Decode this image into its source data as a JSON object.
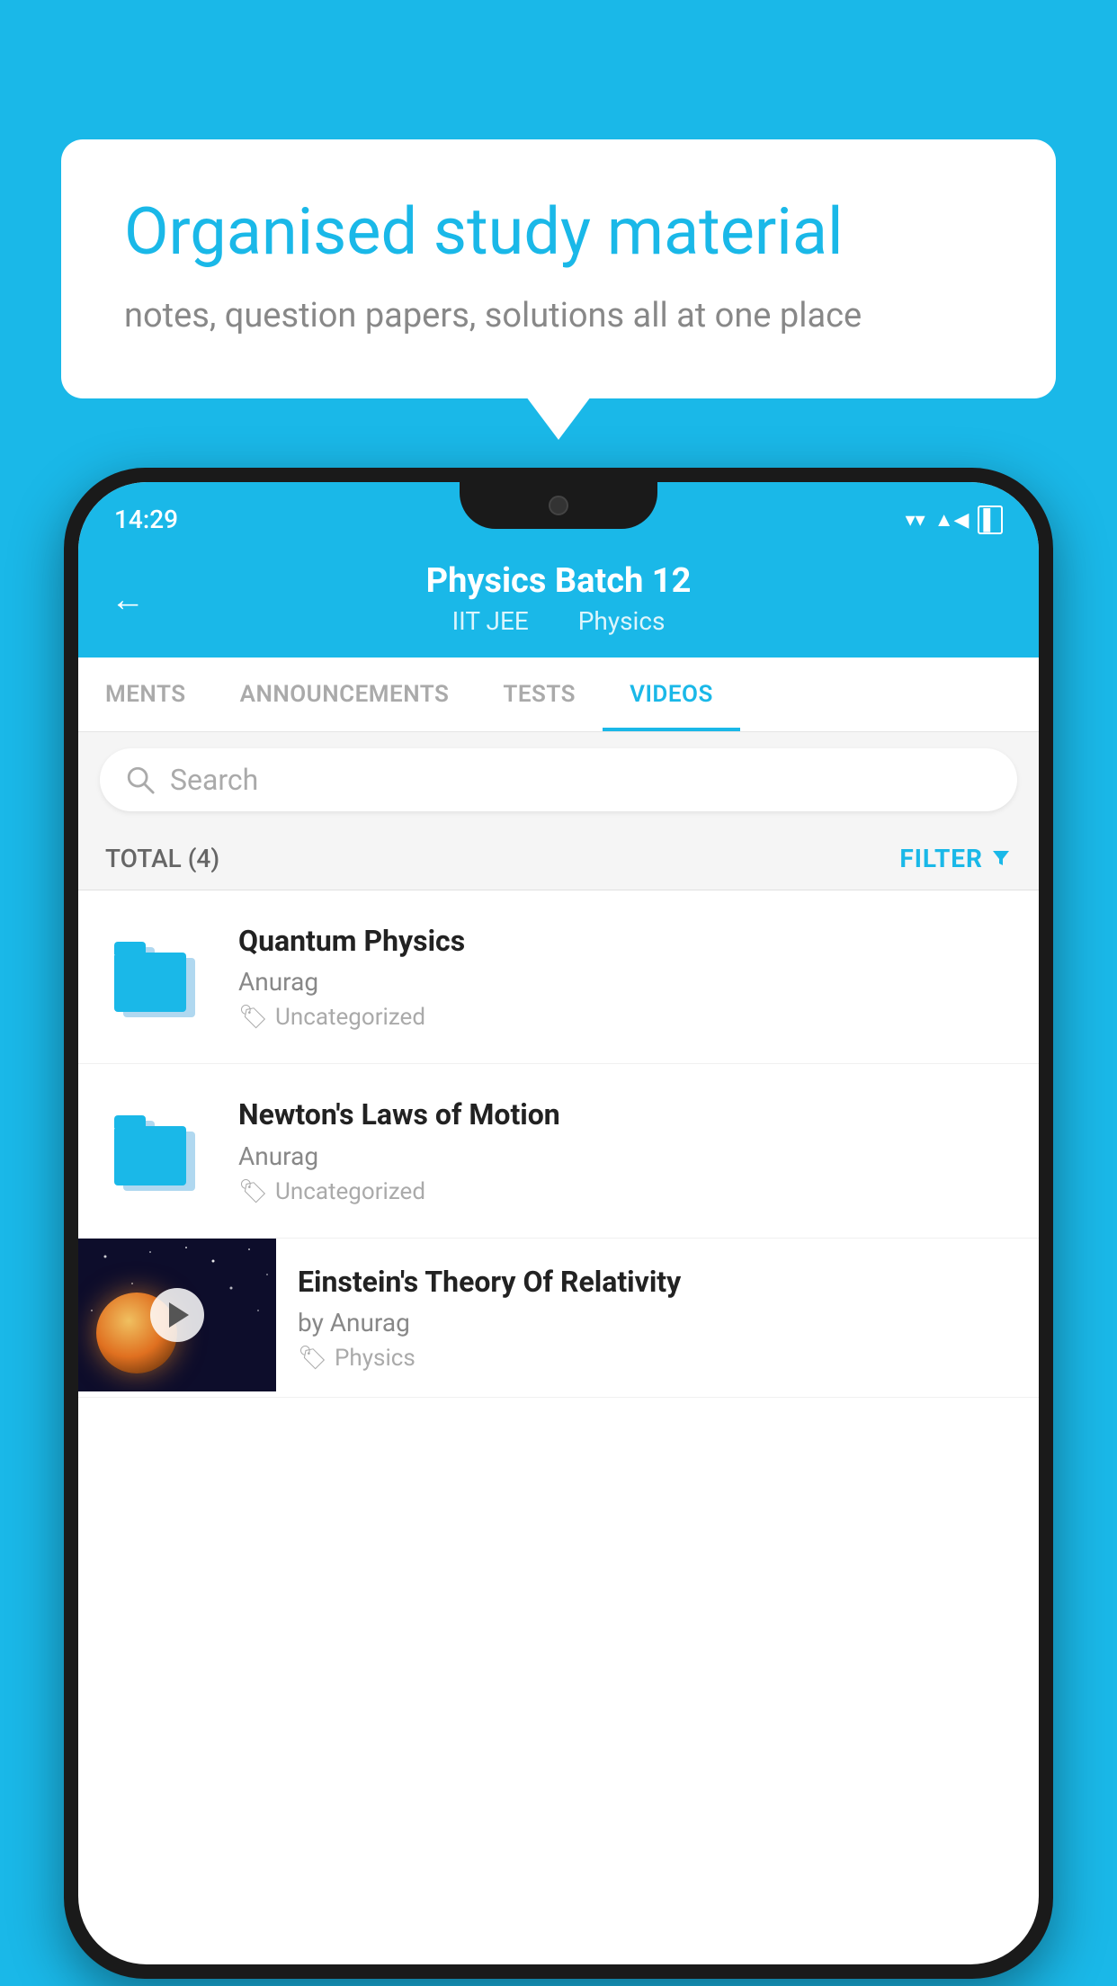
{
  "background": {
    "color": "#1ab8e8"
  },
  "speech_bubble": {
    "title": "Organised study material",
    "subtitle": "notes, question papers, solutions all at one place"
  },
  "phone": {
    "status_bar": {
      "time": "14:29",
      "wifi": "▼",
      "signal": "▲",
      "battery": "▐"
    },
    "header": {
      "back_label": "←",
      "title": "Physics Batch 12",
      "category": "IIT JEE",
      "subject": "Physics"
    },
    "tabs": [
      {
        "label": "MENTS",
        "active": false
      },
      {
        "label": "ANNOUNCEMENTS",
        "active": false
      },
      {
        "label": "TESTS",
        "active": false
      },
      {
        "label": "VIDEOS",
        "active": true
      }
    ],
    "search": {
      "placeholder": "Search"
    },
    "filter_row": {
      "total_label": "TOTAL (4)",
      "filter_label": "FILTER"
    },
    "videos": [
      {
        "title": "Quantum Physics",
        "author": "Anurag",
        "tag": "Uncategorized",
        "has_thumbnail": false
      },
      {
        "title": "Newton's Laws of Motion",
        "author": "Anurag",
        "tag": "Uncategorized",
        "has_thumbnail": false
      },
      {
        "title": "Einstein's Theory Of Relativity",
        "author": "by Anurag",
        "tag": "Physics",
        "has_thumbnail": true
      }
    ]
  }
}
